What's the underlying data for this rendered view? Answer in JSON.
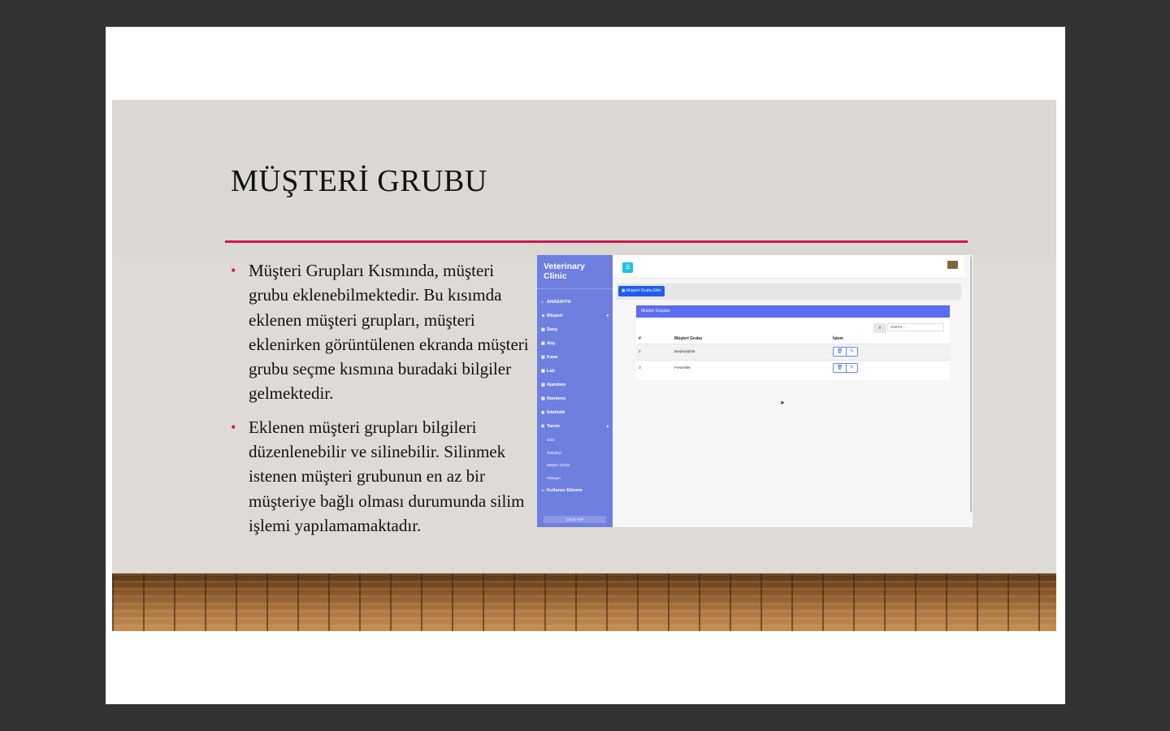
{
  "slide": {
    "title": "MÜŞTERİ GRUBU",
    "bullets": [
      "Müşteri Grupları Kısmında, müşteri grubu eklenebilmektedir. Bu kısımda eklenen müşteri grupları, müşteri eklenirken görüntülenen ekranda müşteri grubu seçme kısmına buradaki bilgiler gelmektedir.",
      "Eklenen müşteri grupları bilgileri düzenlenebilir ve silinebilir. Silinmek istenen müşteri grubunun en az bir müşteriye bağlı olması durumunda silim işlemi yapılamamaktadır."
    ],
    "bullet_symbol": "•"
  },
  "colors": {
    "accent": "#d6174f",
    "sidebar": "#6f7fe0",
    "card_header": "#5b6df0",
    "primary_button": "#1f5cf0",
    "toggle": "#1fc2e0"
  },
  "app": {
    "brand": "Veterinary Clinic",
    "sidebar": {
      "items": [
        {
          "label": "ANASAYFA",
          "icon": "home-icon",
          "glyph": "⌂"
        },
        {
          "label": "Müşteri",
          "icon": "users-icon",
          "glyph": "☻",
          "chevron": "▾"
        },
        {
          "label": "Satış",
          "icon": "cart-icon",
          "glyph": "▤"
        },
        {
          "label": "Alış",
          "icon": "bag-icon",
          "glyph": "▣"
        },
        {
          "label": "Kasa",
          "icon": "cash-icon",
          "glyph": "▥"
        },
        {
          "label": "Lab",
          "icon": "flask-icon",
          "glyph": "▦"
        },
        {
          "label": "Ajandam",
          "icon": "agenda-icon",
          "glyph": "▧"
        },
        {
          "label": "Randevu",
          "icon": "calendar-icon",
          "glyph": "▨"
        },
        {
          "label": "İstatistik",
          "icon": "chart-icon",
          "glyph": "◉"
        },
        {
          "label": "Tanım",
          "icon": "definition-icon",
          "glyph": "⊞",
          "chevron": "▴"
        }
      ],
      "sub_items": [
        "Ürün",
        "Tedarikçi",
        "Müşteri Grubu",
        "Kategori"
      ],
      "after_items": [
        {
          "label": "Kullanıcı Ekleme",
          "icon": "user-add-icon",
          "glyph": "☺"
        }
      ],
      "logout_label": "ÇIKIŞ YAP"
    },
    "toolbar": {
      "toggle_glyph": "☰",
      "add_button_label": "▣ Müşteri Grubu Ekle"
    },
    "card": {
      "title": "Müşteri Grupları",
      "search_placeholder": "arama...",
      "search_glyph": "⌕",
      "columns": [
        "#",
        "Müşteri Grubu",
        "İşlem"
      ],
      "rows": [
        {
          "id": "2",
          "name": "Beşiktaşlılar"
        },
        {
          "id": "3",
          "name": "Fenerliler"
        }
      ],
      "delete_glyph": "🗑",
      "edit_glyph": "✎"
    }
  }
}
